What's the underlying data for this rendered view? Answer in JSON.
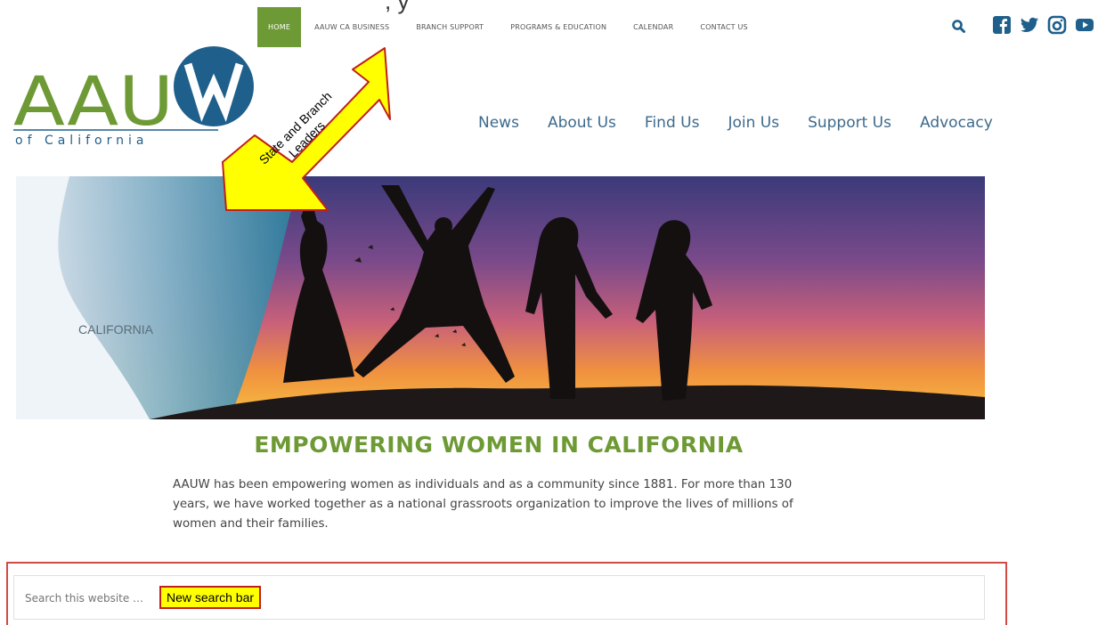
{
  "top_cut_text": ", y",
  "top_nav": {
    "items": [
      "HOME",
      "AAUW CA BUSINESS",
      "BRANCH SUPPORT",
      "PROGRAMS & EDUCATION",
      "CALENDAR",
      "CONTACT US"
    ],
    "active": "HOME"
  },
  "logo": {
    "letters": "AAU",
    "w_letter": "W",
    "subtitle": "of California"
  },
  "main_nav": {
    "items": [
      "News",
      "About Us",
      "Find Us",
      "Join Us",
      "Support Us",
      "Advocacy"
    ]
  },
  "annotation_arrow": {
    "line1": "State and Branch",
    "line2": "Leaders"
  },
  "hero": {
    "map_label": "CALIFORNIA"
  },
  "heading": "EMPOWERING WOMEN IN CALIFORNIA",
  "intro": "AAUW has been empowering women as individuals and as a community since 1881. For more than 130 years, we have worked together as a national grassroots organization to improve the lives of millions of women and their families.",
  "search": {
    "placeholder": "Search this website …"
  },
  "search_callout": "New search bar",
  "social_icons": [
    "facebook-icon",
    "twitter-icon",
    "instagram-icon",
    "youtube-icon"
  ],
  "colors": {
    "green": "#6e9a35",
    "blue": "#1f5f8b",
    "nav_text": "#3d6a8c",
    "highlight_border": "#d24a43",
    "callout_bg": "#ffff00"
  }
}
